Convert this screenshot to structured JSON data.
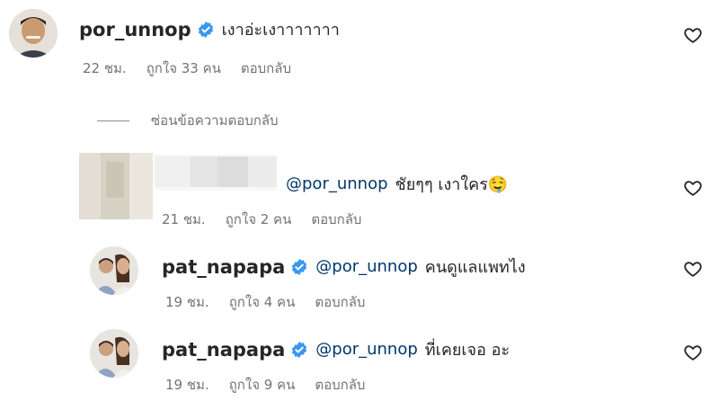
{
  "comments": [
    {
      "username": "por_unnop",
      "verified": true,
      "text": "เงาอ่ะเงาาาาาาา",
      "time": "22 ชม.",
      "likes": "ถูกใจ 33 คน",
      "reply": "ตอบกลับ"
    },
    {
      "username": "",
      "verified": false,
      "mention": "@por_unnop",
      "text": "ชัยๆๆ เงาใคร🤤",
      "time": "21 ชม.",
      "likes": "ถูกใจ 2 คน",
      "reply": "ตอบกลับ"
    },
    {
      "username": "pat_napapa",
      "verified": true,
      "mention": "@por_unnop",
      "text": "คนดูแลแพทไง",
      "time": "19 ชม.",
      "likes": "ถูกใจ 4 คน",
      "reply": "ตอบกลับ"
    },
    {
      "username": "pat_napapa",
      "verified": true,
      "mention": "@por_unnop",
      "text": "ที่เคยเจอ อะ",
      "time": "19 ชม.",
      "likes": "ถูกใจ 9 คน",
      "reply": "ตอบกลับ"
    }
  ],
  "hide_replies_label": "ซ่อนข้อความตอบกลับ",
  "colors": {
    "verified": "#3897f0",
    "mention": "#00376b",
    "meta": "#737373"
  },
  "icons": [
    "verified-badge-icon",
    "heart-icon"
  ]
}
